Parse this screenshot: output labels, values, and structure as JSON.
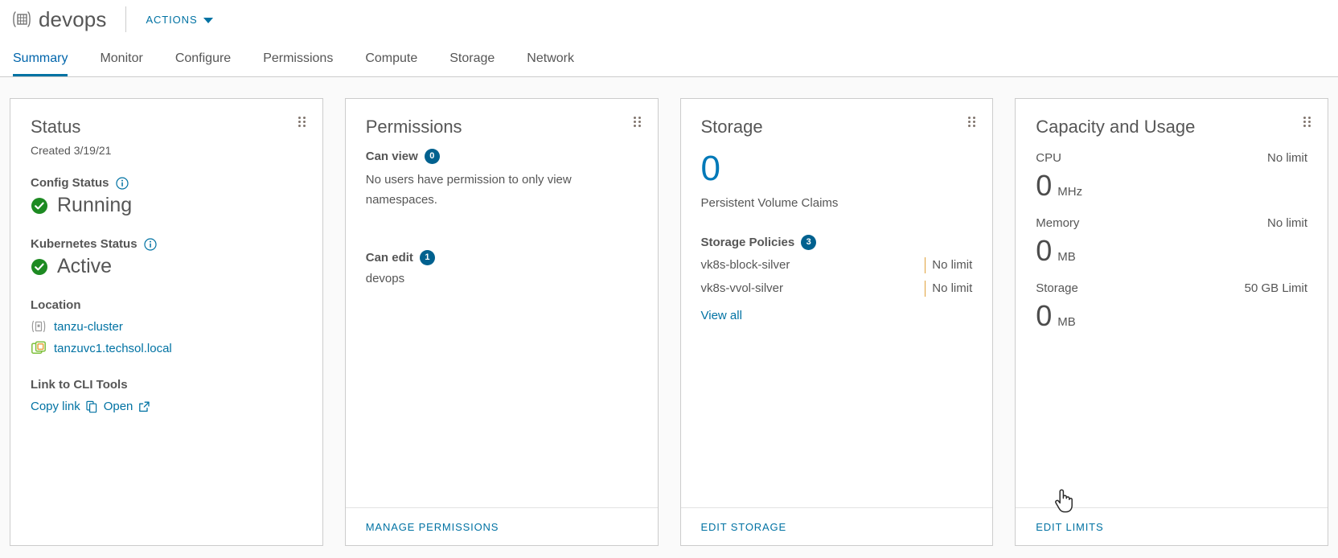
{
  "header": {
    "object_icon": "namespace-icon",
    "title": "devops",
    "actions_label": "ACTIONS",
    "actions_caret": "chevron-down-icon"
  },
  "tabs": [
    {
      "label": "Summary",
      "active": true
    },
    {
      "label": "Monitor",
      "active": false
    },
    {
      "label": "Configure",
      "active": false
    },
    {
      "label": "Permissions",
      "active": false
    },
    {
      "label": "Compute",
      "active": false
    },
    {
      "label": "Storage",
      "active": false
    },
    {
      "label": "Network",
      "active": false
    }
  ],
  "colors": {
    "accent_link": "#0072a3",
    "tab_active": "#0065ab",
    "badge_blue": "#00618f",
    "status_green": "#1d8a22",
    "big_number_blue": "#0079b8",
    "limit_divider_orange": "#e0a23c",
    "text_primary": "#565656",
    "card_border": "#cccccc",
    "page_bg": "#fafafa"
  },
  "cards": {
    "status": {
      "title": "Status",
      "created": "Created 3/19/21",
      "config_status": {
        "label": "Config Status",
        "info_icon": "info-circle-icon",
        "value": "Running",
        "state_icon": "success-check-icon"
      },
      "kubernetes_status": {
        "label": "Kubernetes Status",
        "info_icon": "info-circle-icon",
        "value": "Active",
        "state_icon": "success-check-icon"
      },
      "location": {
        "label": "Location",
        "cluster": "tanzu-cluster",
        "cluster_icon": "cluster-icon",
        "vcenter": "tanzuvc1.techsol.local",
        "vcenter_icon": "vcenter-icon"
      },
      "cli": {
        "label": "Link to CLI Tools",
        "copy_link": "Copy link",
        "copy_icon": "copy-icon",
        "open": "Open",
        "open_icon": "external-link-icon"
      }
    },
    "permissions": {
      "title": "Permissions",
      "can_view": {
        "label": "Can view",
        "count": "0",
        "description": "No users have permission to only view namespaces."
      },
      "can_edit": {
        "label": "Can edit",
        "count": "1",
        "users": "devops"
      },
      "footer_action": "MANAGE PERMISSIONS"
    },
    "storage": {
      "title": "Storage",
      "pvc_count": "0",
      "pvc_caption": "Persistent Volume Claims",
      "policies_label": "Storage Policies",
      "policies_count": "3",
      "policies": [
        {
          "name": "vk8s-block-silver",
          "limit": "No limit"
        },
        {
          "name": "vk8s-vvol-silver",
          "limit": "No limit"
        }
      ],
      "view_all": "View all",
      "footer_action": "EDIT STORAGE"
    },
    "capacity": {
      "title": "Capacity and Usage",
      "metrics": [
        {
          "name": "CPU",
          "limit": "No limit",
          "value": "0",
          "unit": "MHz"
        },
        {
          "name": "Memory",
          "limit": "No limit",
          "value": "0",
          "unit": "MB"
        },
        {
          "name": "Storage",
          "limit": "50 GB Limit",
          "value": "0",
          "unit": "MB"
        }
      ],
      "footer_action": "EDIT LIMITS"
    }
  },
  "cursor": {
    "type": "pointer-hand-cursor"
  }
}
